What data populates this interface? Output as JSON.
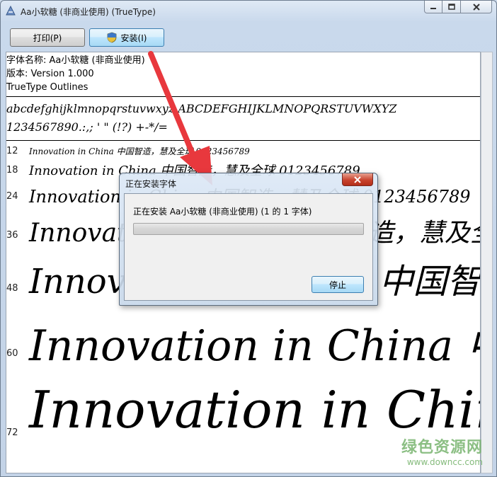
{
  "window": {
    "title": "Aa小软糖 (非商业使用) (TrueType)",
    "icon": "font-a-icon",
    "controls": [
      "minimize-icon",
      "maximize-icon",
      "close-icon"
    ]
  },
  "toolbar": {
    "print_label": "打印(P)",
    "install_label": "安装(I)",
    "install_icon": "uac-shield-icon"
  },
  "font_info": {
    "name_line": "字体名称: Aa小软糖 (非商业使用)",
    "version_line": "版本: Version 1.000",
    "outline_line": "TrueType Outlines"
  },
  "charset": {
    "line1": "abcdefghijklmnopqrstuvwxyz ABCDEFGHIJKLMNOPQRSTUVWXYZ",
    "line2": "1234567890.:,; ' \" (!?) +-*/="
  },
  "samples": [
    {
      "size": "12",
      "text": "Innovation in China 中国智造，慧及全球 0123456789"
    },
    {
      "size": "18",
      "text": "Innovation in China 中国智造，慧及全球 0123456789"
    },
    {
      "size": "24",
      "text": "Innovation in China 中国智造，慧及全球 0123456789"
    },
    {
      "size": "36",
      "text": "Innovation in China 中国智造，慧及全球"
    },
    {
      "size": "48",
      "text": "Innovation in China 中国智造"
    },
    {
      "size": "60",
      "text": "Innovation in China 中"
    },
    {
      "size": "72",
      "text": "Innovation in China"
    }
  ],
  "dialog": {
    "title": "正在安装字体",
    "message": "正在安装 Aa小软糖 (非商业使用) (1 的 1 字体)",
    "progress": 0.0,
    "stop_label": "停止"
  },
  "watermark": {
    "name": "绿色资源网",
    "url": "www.downcc.com"
  },
  "colors": {
    "arrow": "#e8383d",
    "accent_button": "#3c7fb1"
  }
}
